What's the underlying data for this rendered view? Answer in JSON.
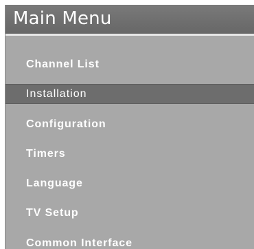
{
  "menu": {
    "title": "Main Menu",
    "items": [
      {
        "label": "Channel List",
        "selected": false
      },
      {
        "label": "Installation",
        "selected": true
      },
      {
        "label": "Configuration",
        "selected": false
      },
      {
        "label": "Timers",
        "selected": false
      },
      {
        "label": "Language",
        "selected": false
      },
      {
        "label": "TV Setup",
        "selected": false
      },
      {
        "label": "Common Interface",
        "selected": false
      }
    ]
  },
  "colors": {
    "panel_background": "#a8a8a8",
    "header_background": "#707070",
    "selected_row": "#6d6d6d",
    "text": "#ffffff"
  }
}
